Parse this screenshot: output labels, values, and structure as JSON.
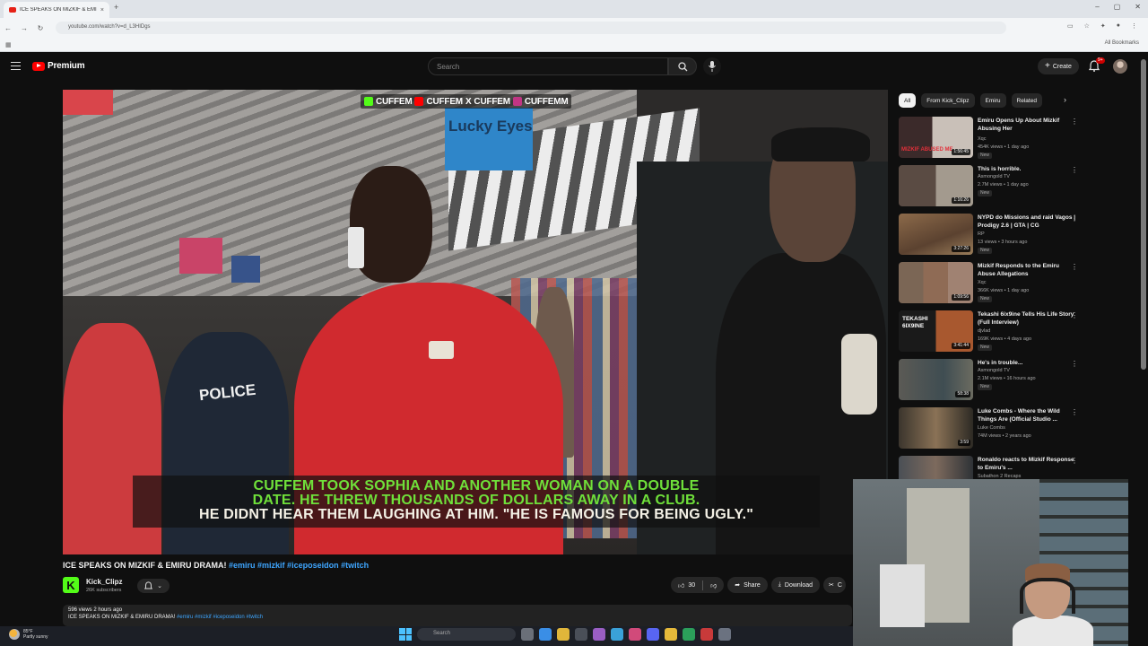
{
  "browser": {
    "tab_title": "ICE SPEAKS ON MIZKIF & EMIRU DRAMA! #emiru - YouTube",
    "tab_close": "×",
    "new_tab": "+",
    "url": "youtube.com/watch?v=d_L3HIDgs",
    "all_bookmarks": "All Bookmarks",
    "window_controls": [
      "–",
      "▢",
      "✕"
    ]
  },
  "header": {
    "logo_text": "Premium",
    "search_placeholder": "Search",
    "create_label": "Create",
    "notification_count": "9+"
  },
  "video": {
    "watermark": [
      "CUFFEM",
      "CUFFEM",
      "CUFFEM",
      "CUFFEMM"
    ],
    "watermark_separator": "X",
    "store_sign": "Lucky Eyes",
    "jacket_text": "POLICE",
    "caption_line1": "CUFFEM TOOK SOPHIA AND ANOTHER WOMAN ON A DOUBLE",
    "caption_line2": "DATE. HE THREW THOUSANDS OF DOLLARS AWAY IN A CLUB.",
    "caption_line3": "HE DIDNT HEAR THEM LAUGHING AT HIM. \"HE IS FAMOUS FOR BEING UGLY.\"",
    "title": "ICE SPEAKS ON MIZKIF & EMIRU DRAMA!",
    "title_tags": "#emiru #mizkif #iceposeidon #twitch",
    "channel_name": "Kick_Clipz",
    "channel_avatar_letter": "K",
    "subscribers": "26K subscribers",
    "likes": "30",
    "share_label": "Share",
    "download_label": "Download",
    "clip_label": "C",
    "description_stats": "596 views  2 hours ago",
    "description_text": "ICE SPEAKS ON MIZKIF & EMIRU DRAMA!",
    "description_tags": "#emiru #mizkif #iceposeidon #twitch"
  },
  "chips": [
    "All",
    "From Kick_Clipz",
    "Emiru",
    "Related"
  ],
  "recommendations": [
    {
      "title": "Emiru Opens Up About Mizkif Abusing Her",
      "channel": "Xqc",
      "meta": "454K views • 1 day ago",
      "badge": "New",
      "duration": "1:56:45",
      "thumb_label": "MIZKIF ABUSED ME"
    },
    {
      "title": "This is horrible.",
      "channel": "Asmongold TV",
      "meta": "2.7M views • 1 day ago",
      "badge": "New",
      "duration": "1:16:26",
      "thumb_label": ""
    },
    {
      "title": "NYPD do Missions and raid Vagos | Prodigy 2.6 | GTA | CG",
      "channel": "RP",
      "meta": "13 views • 3 hours ago",
      "badge": "New",
      "duration": "3:27:26",
      "thumb_label": ""
    },
    {
      "title": "Mizkif Responds to the Emiru Abuse Allegations",
      "channel": "Xqc",
      "meta": "366K views • 1 day ago",
      "badge": "New",
      "duration": "1:09:56",
      "thumb_label": ""
    },
    {
      "title": "Tekashi 6ix9ine Tells His Life Story (Full Interview)",
      "channel": "djvlad",
      "meta": "169K views • 4 days ago",
      "badge": "New",
      "duration": "3:41:44",
      "thumb_label": "TEKASHI 6IX9INE"
    },
    {
      "title": "He's in trouble...",
      "channel": "Asmongold TV",
      "meta": "2.1M views • 16 hours ago",
      "badge": "New",
      "duration": "58:38",
      "thumb_label": ""
    },
    {
      "title": "Luke Combs - Where the Wild Things Are (Official Studio ...",
      "channel": "Luke Combs",
      "meta": "74M views • 2 years ago",
      "badge": "",
      "duration": "3:59",
      "thumb_label": ""
    },
    {
      "title": "Ronaldo reacts to Mizkif Response to Emiru's ...",
      "channel": "Subathon 2 Recaps",
      "meta": "",
      "badge": "",
      "duration": "",
      "thumb_label": ""
    }
  ],
  "taskbar": {
    "weather_temp": "85°F",
    "weather_desc": "Partly sunny",
    "search_placeholder": "Search"
  },
  "colors": {
    "background": "#0f0f0f",
    "accent_red": "#ff0000",
    "link_blue": "#3ea6ff",
    "kick_green": "#53fc18",
    "caption_green": "#6fe03a"
  }
}
